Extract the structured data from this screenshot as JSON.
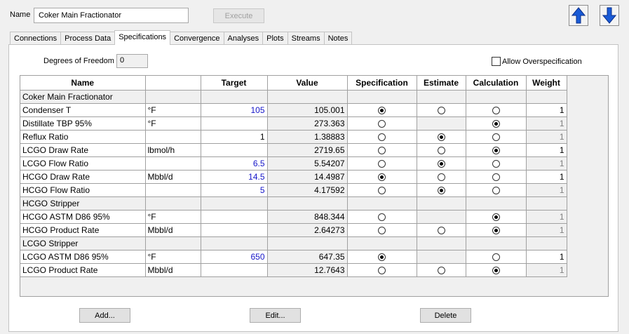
{
  "header": {
    "name_label": "Name",
    "name_value": "Coker Main Fractionator",
    "execute_label": "Execute"
  },
  "tabs": [
    {
      "label": "Connections"
    },
    {
      "label": "Process Data"
    },
    {
      "label": "Specifications"
    },
    {
      "label": "Convergence"
    },
    {
      "label": "Analyses"
    },
    {
      "label": "Plots"
    },
    {
      "label": "Streams"
    },
    {
      "label": "Notes"
    }
  ],
  "dof": {
    "label": "Degrees of Freedom",
    "value": "0"
  },
  "allow_overspec": {
    "label": "Allow Overspecification",
    "checked": false
  },
  "columns": [
    "Name",
    "",
    "Target",
    "Value",
    "Specification",
    "Estimate",
    "Calculation",
    "Weight"
  ],
  "rows": [
    {
      "group": true,
      "name": "Coker Main Fractionator"
    },
    {
      "name": "Condenser T",
      "unit": "°F",
      "target": "105",
      "target_blue": true,
      "value": "105.001",
      "mode": "spec",
      "estimate_enabled": true,
      "weight": "1",
      "weight_dim": false
    },
    {
      "name": "Distillate TBP 95%",
      "unit": "°F",
      "target": "",
      "value": "273.363",
      "mode": "calc",
      "estimate_enabled": false,
      "weight": "1",
      "weight_dim": true
    },
    {
      "name": "Reflux Ratio",
      "unit": "",
      "target": "1",
      "target_blue": false,
      "value": "1.38883",
      "mode": "est",
      "estimate_enabled": true,
      "weight": "1",
      "weight_dim": true
    },
    {
      "name": "LCGO Draw Rate",
      "unit": "lbmol/h",
      "target": "",
      "value": "2719.65",
      "mode": "calc",
      "estimate_enabled": true,
      "weight": "1",
      "weight_dim": false
    },
    {
      "name": "LCGO Flow Ratio",
      "unit": "",
      "target": "6.5",
      "target_blue": true,
      "value": "5.54207",
      "mode": "est",
      "estimate_enabled": true,
      "weight": "1",
      "weight_dim": true
    },
    {
      "name": "HCGO Draw Rate",
      "unit": "Mbbl/d",
      "target": "14.5",
      "target_blue": true,
      "value": "14.4987",
      "mode": "spec",
      "estimate_enabled": true,
      "weight": "1",
      "weight_dim": false
    },
    {
      "name": "HCGO Flow Ratio",
      "unit": "",
      "target": "5",
      "target_blue": true,
      "value": "4.17592",
      "mode": "est",
      "estimate_enabled": true,
      "weight": "1",
      "weight_dim": true
    },
    {
      "group": true,
      "name": "HCGO Stripper"
    },
    {
      "name": "HCGO ASTM D86 95%",
      "unit": "°F",
      "target": "",
      "value": "848.344",
      "mode": "calc",
      "estimate_enabled": false,
      "weight": "1",
      "weight_dim": true
    },
    {
      "name": "HCGO Product Rate",
      "unit": "Mbbl/d",
      "target": "",
      "value": "2.64273",
      "mode": "calc",
      "estimate_enabled": true,
      "weight": "1",
      "weight_dim": true
    },
    {
      "group": true,
      "name": "LCGO Stripper"
    },
    {
      "name": "LCGO ASTM D86 95%",
      "unit": "°F",
      "target": "650",
      "target_blue": true,
      "value": "647.35",
      "mode": "spec",
      "estimate_enabled": false,
      "weight": "1",
      "weight_dim": false
    },
    {
      "name": "LCGO Product Rate",
      "unit": "Mbbl/d",
      "target": "",
      "value": "12.7643",
      "mode": "calc",
      "estimate_enabled": true,
      "weight": "1",
      "weight_dim": true
    }
  ],
  "footer": {
    "add_label": "Add...",
    "edit_label": "Edit...",
    "delete_label": "Delete"
  },
  "colors": {
    "accent_blue": "#1a5bd6",
    "target_blue": "#1515c8",
    "dim_text": "#808080"
  },
  "icons": {
    "up": "arrow-up-icon",
    "down": "arrow-down-icon"
  }
}
